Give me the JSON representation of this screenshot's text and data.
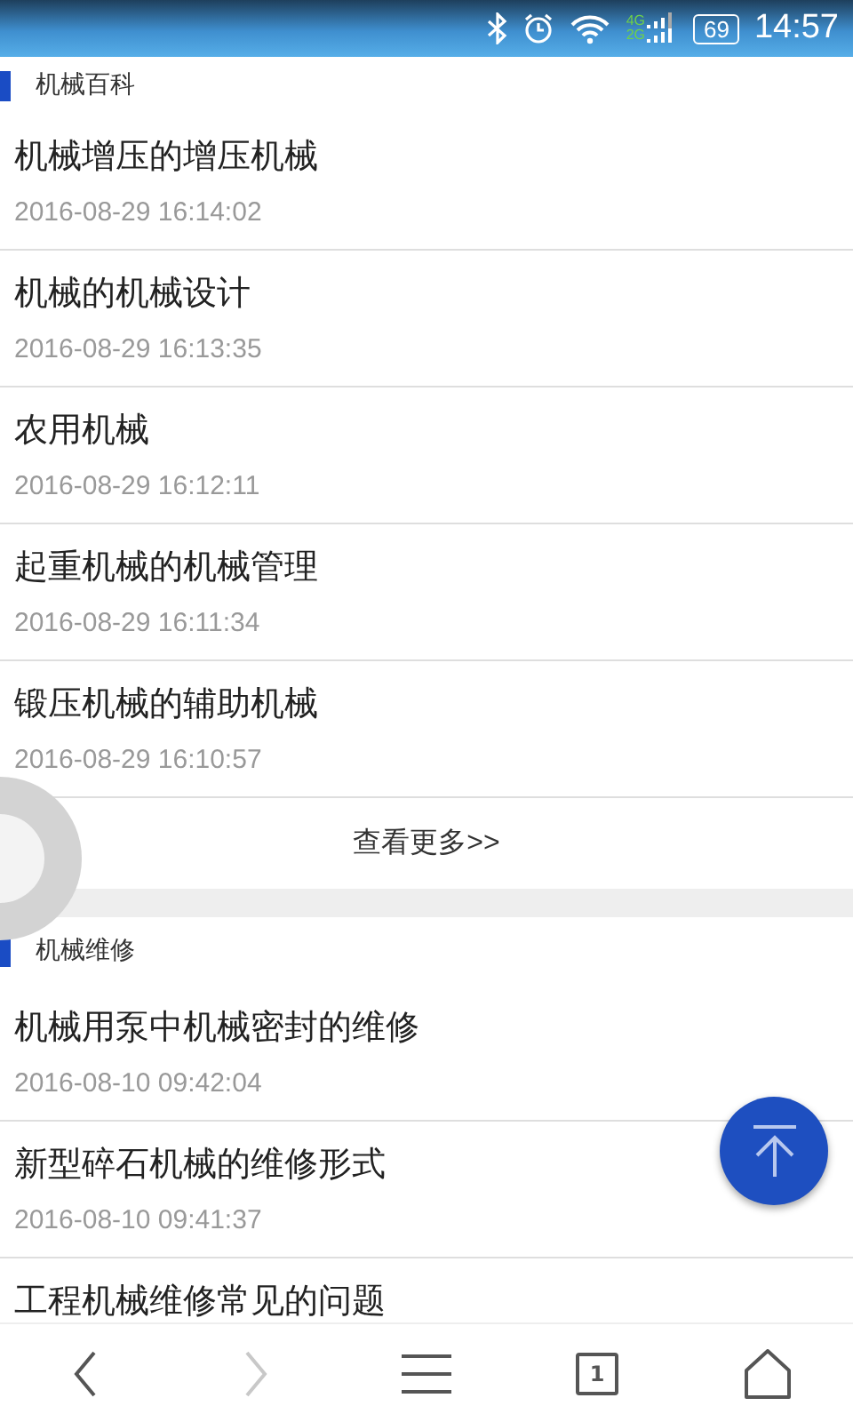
{
  "status_bar": {
    "network_labels": [
      "4G",
      "2G"
    ],
    "battery": "69",
    "time": "14:57"
  },
  "sections": [
    {
      "title": "机械百科",
      "items": [
        {
          "title": "机械增压的增压机械",
          "date": "2016-08-29 16:14:02"
        },
        {
          "title": "机械的机械设计",
          "date": "2016-08-29 16:13:35"
        },
        {
          "title": "农用机械",
          "date": "2016-08-29 16:12:11"
        },
        {
          "title": "起重机械的机械管理",
          "date": "2016-08-29 16:11:34"
        },
        {
          "title": "锻压机械的辅助机械",
          "date": "2016-08-29 16:10:57"
        }
      ],
      "more": "查看更多>>"
    },
    {
      "title": "机械维修",
      "items": [
        {
          "title": "机械用泵中机械密封的维修",
          "date": "2016-08-10 09:42:04"
        },
        {
          "title": "新型碎石机械的维修形式",
          "date": "2016-08-10 09:41:37"
        },
        {
          "title": "工程机械维修常见的问题"
        }
      ]
    }
  ],
  "nav": [
    {
      "kind": "back",
      "disabled": false
    },
    {
      "kind": "forward",
      "disabled": true
    },
    {
      "kind": "menu",
      "disabled": false
    },
    {
      "kind": "tabs",
      "disabled": false,
      "count": "1"
    },
    {
      "kind": "home",
      "disabled": false
    }
  ]
}
